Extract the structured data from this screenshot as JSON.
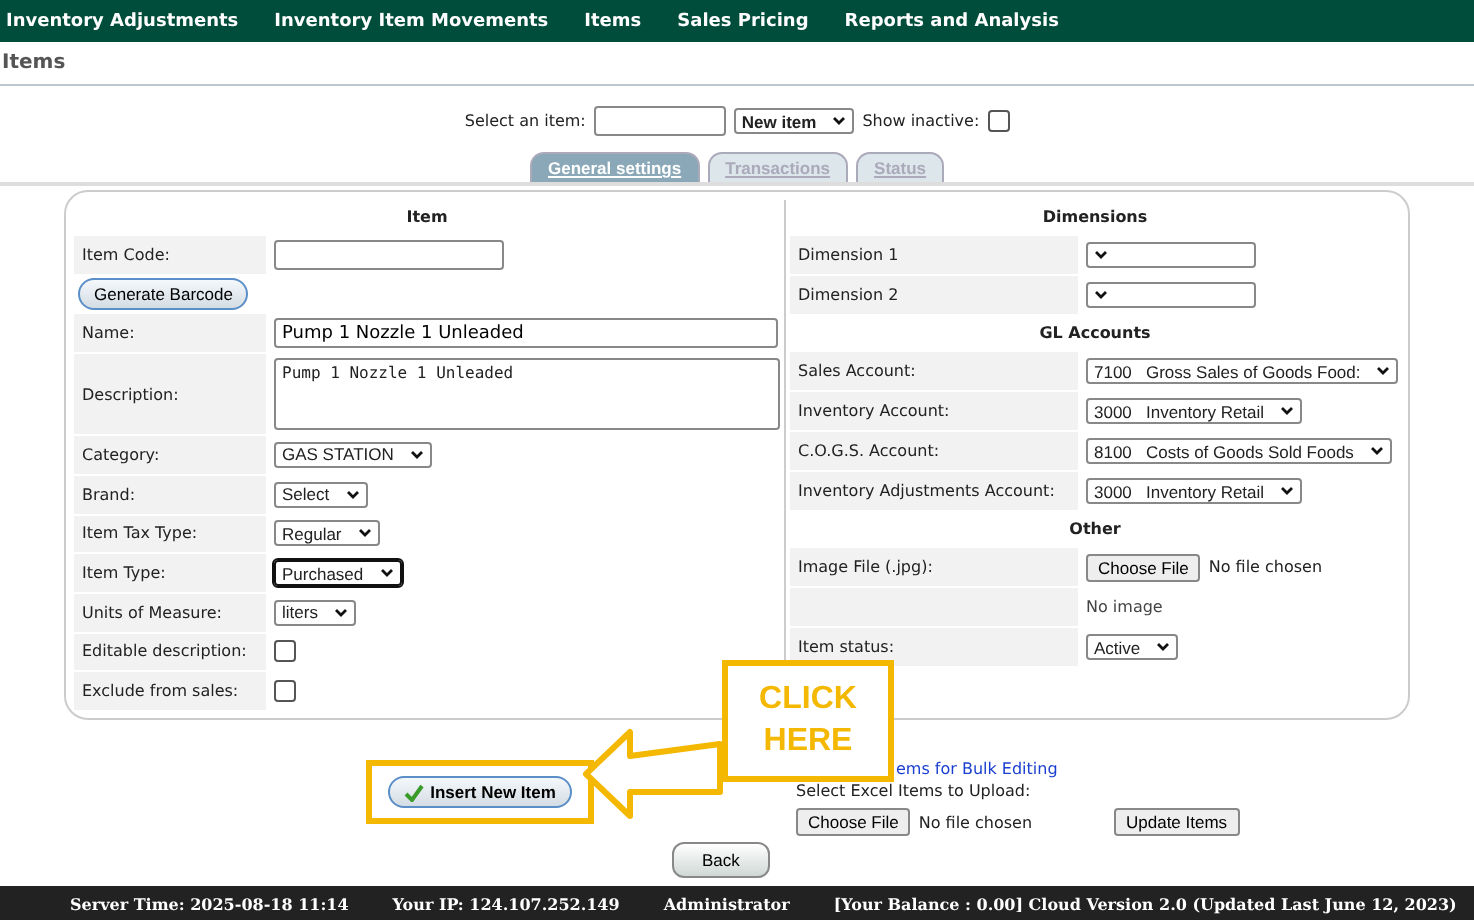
{
  "nav": [
    "Inventory Adjustments",
    "Inventory Item Movements",
    "Items",
    "Sales Pricing",
    "Reports and Analysis"
  ],
  "page_title": "Items",
  "selector": {
    "label": "Select an item:",
    "dropdown": "New item",
    "inactive_label": "Show inactive:",
    "inactive_checked": false
  },
  "tabs": [
    {
      "label": "General settings",
      "selected": true
    },
    {
      "label": "Transactions",
      "selected": false
    },
    {
      "label": "Status",
      "selected": false
    }
  ],
  "item_section": {
    "title": "Item",
    "rows": [
      {
        "kind": "text",
        "label": "Item Code:",
        "value": ""
      },
      {
        "kind": "button",
        "label": "Generate Barcode"
      },
      {
        "kind": "wide",
        "label": "Name:",
        "value": "Pump 1 Nozzle 1 Unleaded"
      },
      {
        "kind": "textarea",
        "label": "Description:",
        "value": "Pump 1 Nozzle 1 Unleaded"
      },
      {
        "kind": "select",
        "label": "Category:",
        "value": "GAS STATION"
      },
      {
        "kind": "select",
        "label": "Brand:",
        "value": "Select"
      },
      {
        "kind": "select",
        "label": "Item Tax Type:",
        "value": "Regular"
      },
      {
        "kind": "select",
        "label": "Item Type:",
        "value": "Purchased",
        "focused": true
      },
      {
        "kind": "select",
        "label": "Units of Measure:",
        "value": "liters"
      },
      {
        "kind": "checkbox",
        "label": "Editable description:",
        "checked": false
      },
      {
        "kind": "checkbox",
        "label": "Exclude from sales:",
        "checked": false
      }
    ]
  },
  "right_sections": [
    {
      "title": "Dimensions",
      "rows": [
        {
          "kind": "select",
          "label": "Dimension 1"
        },
        {
          "kind": "select",
          "label": "Dimension 2"
        }
      ]
    },
    {
      "title": "GL Accounts",
      "rows": [
        {
          "kind": "select",
          "label": "Sales Account:",
          "value": "7100   Gross Sales of Goods Food:"
        },
        {
          "kind": "select",
          "label": "Inventory Account:",
          "value": "3000   Inventory Retail"
        },
        {
          "kind": "select",
          "label": "C.O.G.S. Account:",
          "value": "8100   Costs of Goods Sold Foods"
        },
        {
          "kind": "select",
          "label": "Inventory Adjustments Account:",
          "value": "3000   Inventory Retail"
        }
      ]
    },
    {
      "title": "Other",
      "rows": [
        {
          "kind": "file",
          "label": "Image File (.jpg):",
          "button": "Choose File",
          "status": "No file chosen"
        },
        {
          "kind": "note",
          "value": "No image"
        },
        {
          "kind": "select",
          "label": "Item status:",
          "value": "Active"
        }
      ]
    }
  ],
  "insert_button": "Insert New Item",
  "callout": "CLICK HERE",
  "bulk": {
    "link": "ems for Bulk Editing",
    "label": "Select Excel Items to Upload:",
    "button": "Choose File",
    "status": "No file chosen",
    "update": "Update Items"
  },
  "back_button": "Back",
  "footer": [
    "Server Time: 2025-08-18 11:14",
    "Your IP: 124.107.252.149",
    "Administrator",
    "[Your Balance : 0.00] Cloud Version 2.0 (Updated Last June 12, 2023)"
  ]
}
